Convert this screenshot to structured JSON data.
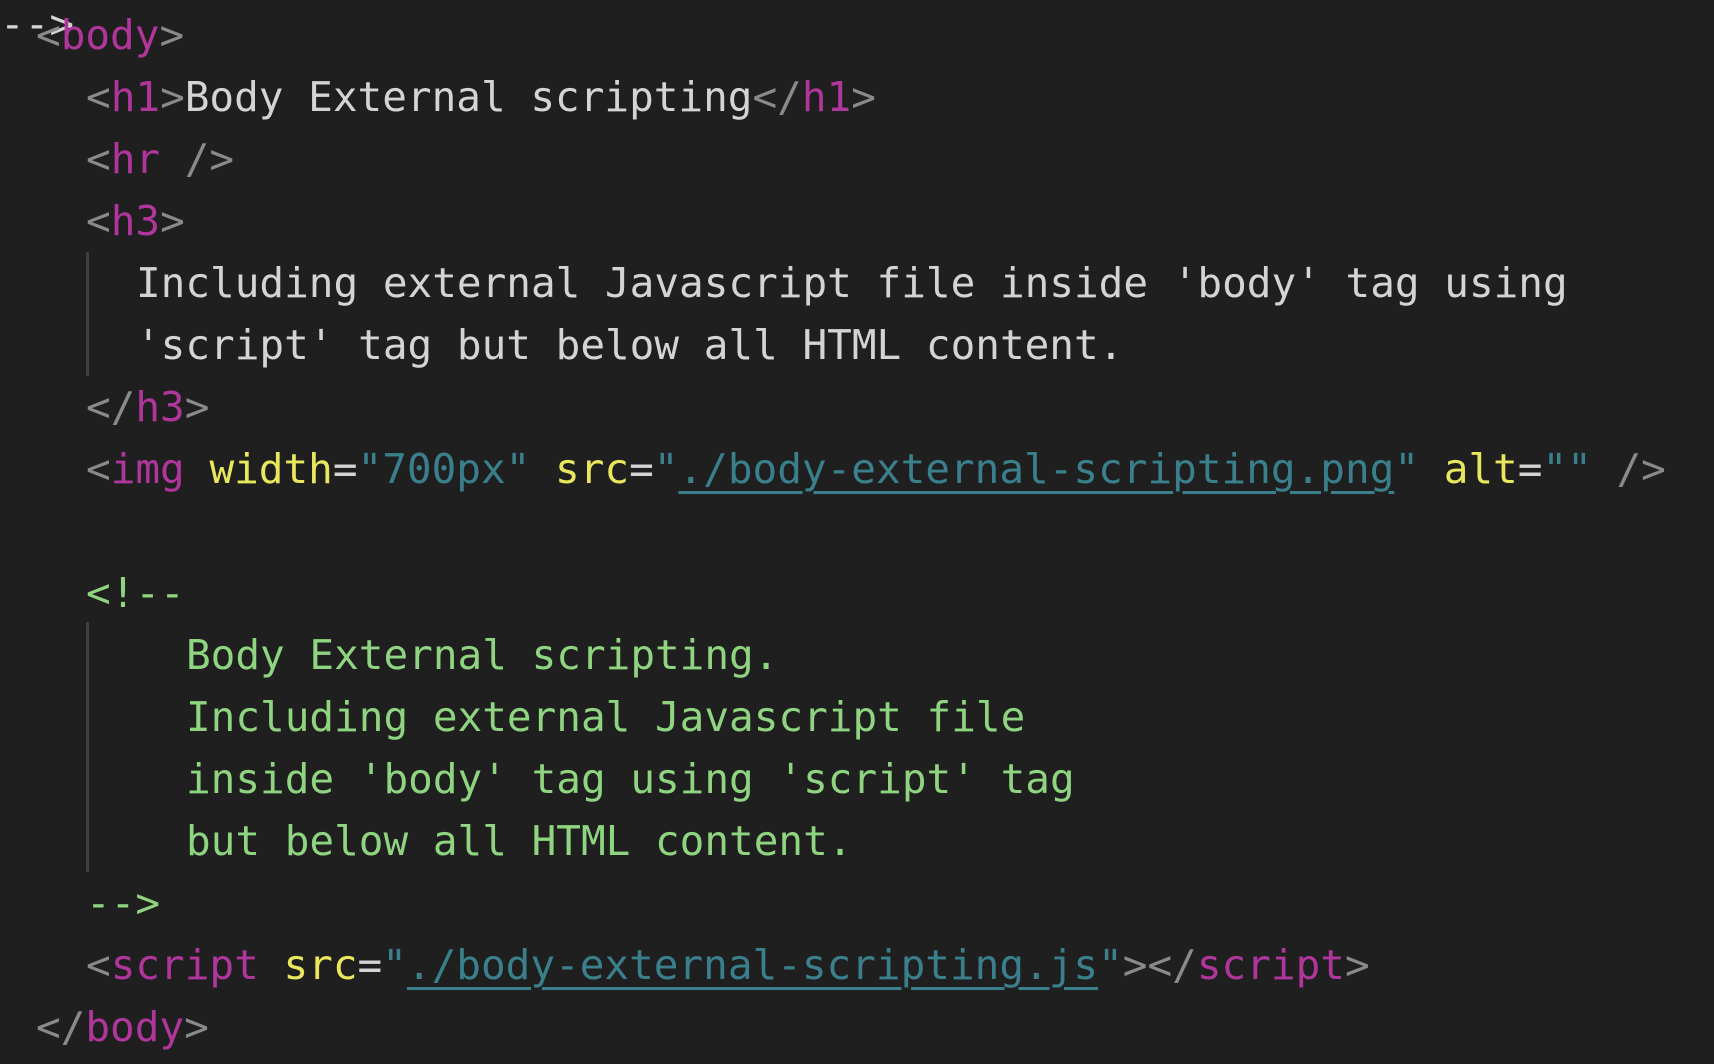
{
  "code": {
    "body_tag": "body",
    "h1_tag": "h1",
    "h1_text": "Body External scripting",
    "hr_tag": "hr",
    "h3_tag": "h3",
    "h3_line1": "Including external Javascript file inside 'body' tag using",
    "h3_line2": "'script' tag but below all HTML content.",
    "img_tag": "img",
    "img_width_attr": "width",
    "img_width_value": "700px",
    "img_src_attr": "src",
    "img_src_value": "./body-external-scripting.png",
    "img_alt_attr": "alt",
    "img_alt_value": "",
    "comment_open": "<!--",
    "comment_lines": [
      "Body External scripting.",
      "Including external Javascript file",
      "inside 'body' tag using 'script' tag",
      "but below all HTML content."
    ],
    "comment_close": "-->",
    "script_tag": "script",
    "script_src_attr": "src",
    "script_src_value": "./body-external-scripting.js"
  },
  "colors": {
    "background": "#1f1f1f",
    "punctuation": "#8a8a8a",
    "tag": "#b0369c",
    "attribute": "#e8e75e",
    "string": "#3a7f8c",
    "text": "#d4d4d4",
    "comment": "#8fd480"
  }
}
